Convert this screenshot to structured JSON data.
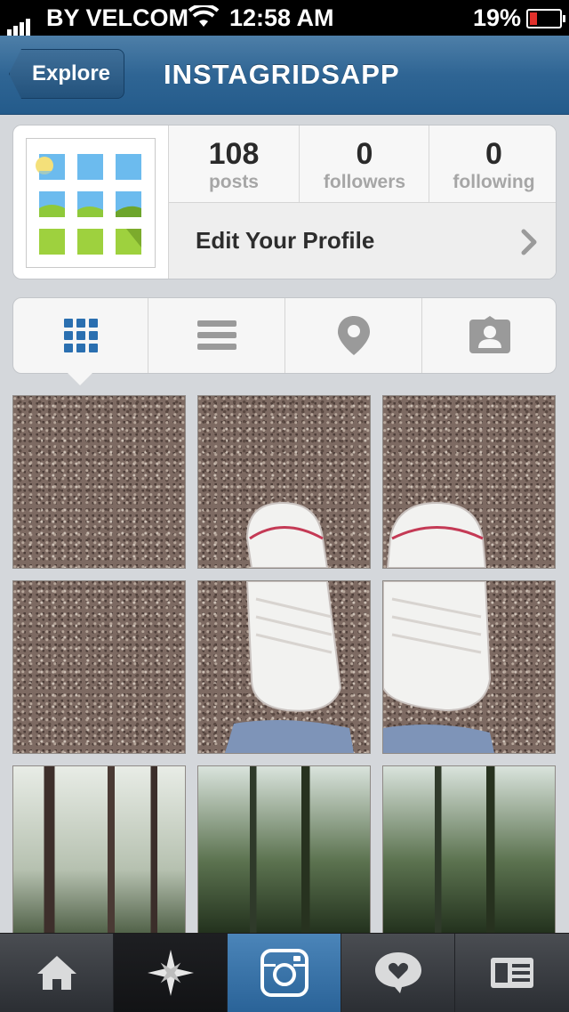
{
  "status_bar": {
    "carrier": "BY VELCOM",
    "time": "12:58 AM",
    "battery": "19%"
  },
  "nav": {
    "back_label": "Explore",
    "title": "INSTAGRIDSAPP"
  },
  "profile": {
    "stats": [
      {
        "value": "108",
        "label": "posts"
      },
      {
        "value": "0",
        "label": "followers"
      },
      {
        "value": "0",
        "label": "following"
      }
    ],
    "edit_label": "Edit Your Profile"
  },
  "tabs": [
    {
      "icon": "grid-icon",
      "active": true
    },
    {
      "icon": "list-icon",
      "active": false
    },
    {
      "icon": "location-pin-icon",
      "active": false
    },
    {
      "icon": "tagged-person-icon",
      "active": false
    }
  ],
  "photos": [
    "gravel",
    "gravel-shoe-left",
    "gravel-shoe-right",
    "gravel",
    "gravel-shoe-left-lower",
    "gravel-shoe-right-lower",
    "forest",
    "forest",
    "forest"
  ],
  "bottom_tabs": [
    {
      "icon": "home-icon",
      "active": false
    },
    {
      "icon": "explore-star-icon",
      "active": false
    },
    {
      "icon": "camera-icon",
      "active": true
    },
    {
      "icon": "activity-heart-icon",
      "active": false
    },
    {
      "icon": "profile-card-icon",
      "active": false
    }
  ],
  "colors": {
    "nav_blue": "#2f6594",
    "active_tab_blue": "#2a6398",
    "grid_icon_blue": "#2a6fb0"
  }
}
